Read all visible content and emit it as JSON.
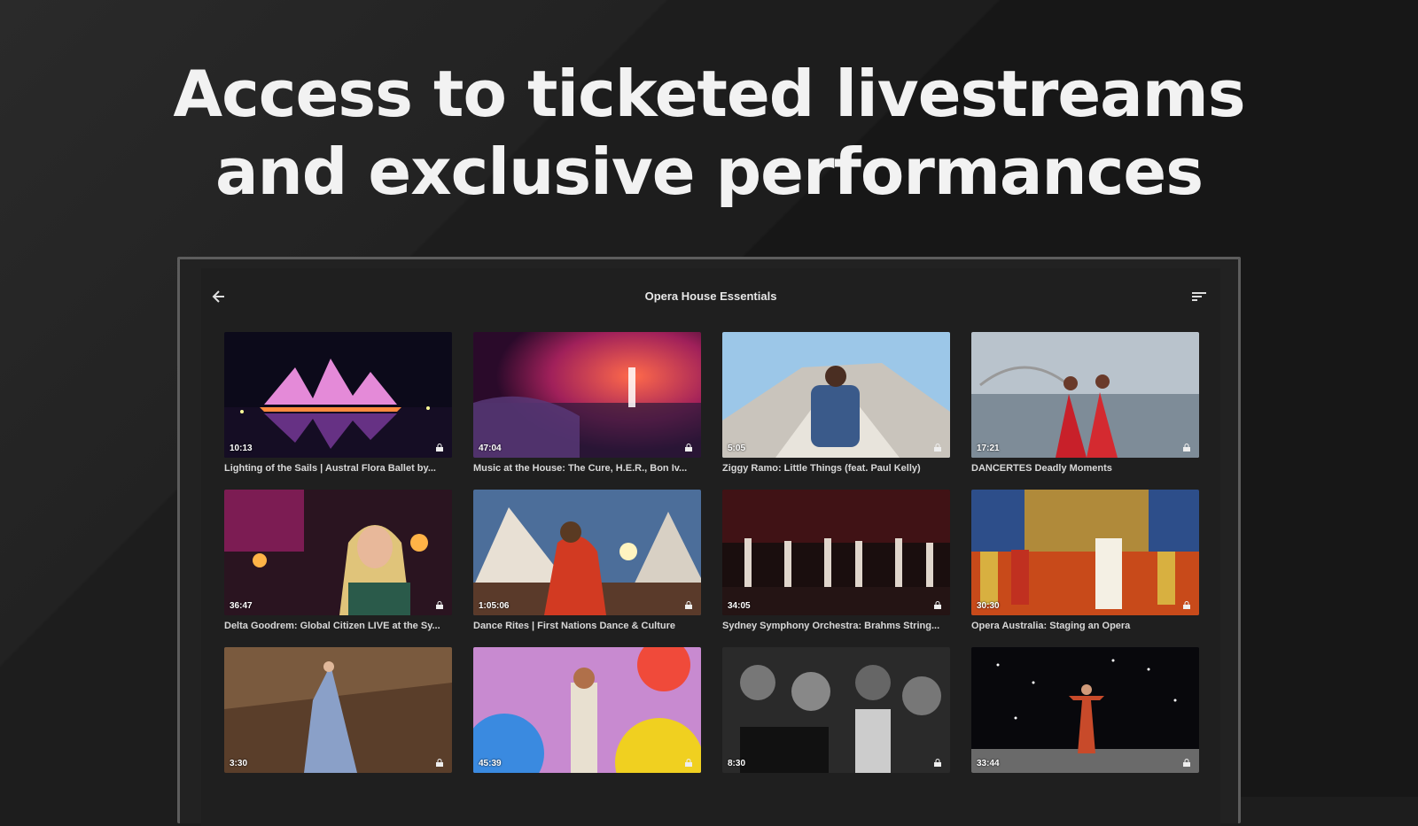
{
  "headline": {
    "line1": "Access to ticketed livestreams",
    "line2": "and exclusive performances"
  },
  "app": {
    "title": "Opera House Essentials",
    "back_icon": "arrow-left-icon",
    "sort_icon": "sort-icon"
  },
  "videos": [
    {
      "duration": "10:13",
      "title": "Lighting of the Sails | Austral Flora Ballet by...",
      "locked": true
    },
    {
      "duration": "47:04",
      "title": "Music at the House: The Cure, H.E.R., Bon Iv...",
      "locked": true
    },
    {
      "duration": "5:05",
      "title": "Ziggy Ramo: Little Things (feat. Paul Kelly)",
      "locked": true
    },
    {
      "duration": "17:21",
      "title": "DANCERTES Deadly Moments",
      "locked": true
    },
    {
      "duration": "36:47",
      "title": "Delta Goodrem: Global Citizen LIVE at the Sy...",
      "locked": true
    },
    {
      "duration": "1:05:06",
      "title": "Dance Rites | First Nations Dance & Culture",
      "locked": true
    },
    {
      "duration": "34:05",
      "title": "Sydney Symphony Orchestra: Brahms String...",
      "locked": true
    },
    {
      "duration": "30:30",
      "title": "Opera Australia: Staging an Opera",
      "locked": true
    },
    {
      "duration": "3:30",
      "title": "",
      "locked": true
    },
    {
      "duration": "45:39",
      "title": "",
      "locked": true
    },
    {
      "duration": "8:30",
      "title": "",
      "locked": true
    },
    {
      "duration": "33:44",
      "title": "",
      "locked": true
    }
  ]
}
